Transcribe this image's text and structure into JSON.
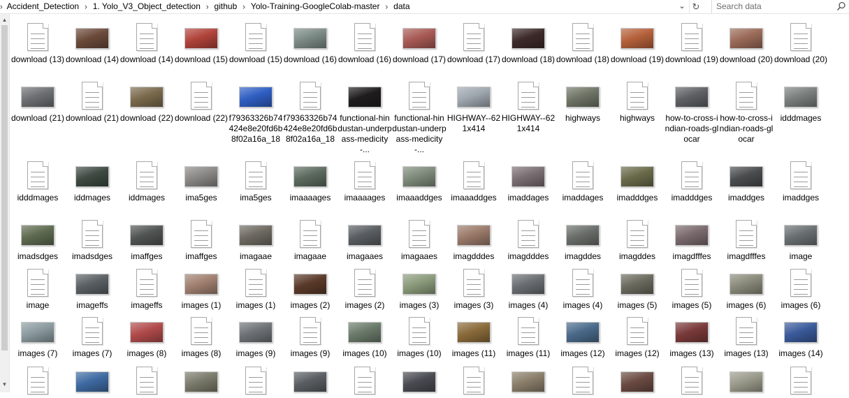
{
  "breadcrumb": [
    "Accident_Detection",
    "1. Yolo_V3_Object_detection",
    "github",
    "Yolo-Training-GoogleColab-master",
    "data"
  ],
  "search": {
    "placeholder": "Search data"
  },
  "icons": {
    "separator": "chevron-right-icon",
    "dropdown": "chevron-down-icon",
    "refresh": "refresh-icon",
    "search": "search-icon"
  },
  "files": [
    {
      "name": "download (13)",
      "kind": "text",
      "color": ""
    },
    {
      "name": "download (14)",
      "kind": "image",
      "color": "#6b4a3a"
    },
    {
      "name": "download (14)",
      "kind": "text",
      "color": ""
    },
    {
      "name": "download (15)",
      "kind": "image",
      "color": "#b0433a"
    },
    {
      "name": "download (15)",
      "kind": "text",
      "color": ""
    },
    {
      "name": "download (16)",
      "kind": "image",
      "color": "#7c8a86"
    },
    {
      "name": "download (16)",
      "kind": "text",
      "color": ""
    },
    {
      "name": "download (17)",
      "kind": "image",
      "color": "#a85a55"
    },
    {
      "name": "download (17)",
      "kind": "text",
      "color": ""
    },
    {
      "name": "download (18)",
      "kind": "image",
      "color": "#3d2a2a"
    },
    {
      "name": "download (18)",
      "kind": "text",
      "color": ""
    },
    {
      "name": "download (19)",
      "kind": "image",
      "color": "#b5603a"
    },
    {
      "name": "download (19)",
      "kind": "text",
      "color": ""
    },
    {
      "name": "download (20)",
      "kind": "image",
      "color": "#9a6a58"
    },
    {
      "name": "download (20)",
      "kind": "text",
      "color": ""
    },
    {
      "name": "download (21)",
      "kind": "image",
      "color": "#6d6f72"
    },
    {
      "name": "download (21)",
      "kind": "text",
      "color": ""
    },
    {
      "name": "download (22)",
      "kind": "image",
      "color": "#7a6a4c"
    },
    {
      "name": "download (22)",
      "kind": "text",
      "color": ""
    },
    {
      "name": "f79363326b74424e8e20fd6b8f02a16a_18",
      "kind": "image",
      "color": "#2f5ec2"
    },
    {
      "name": "f79363326b74424e8e20fd6b8f02a16a_18",
      "kind": "text",
      "color": ""
    },
    {
      "name": "functional-hindustan-underpass-medicity-...",
      "kind": "image",
      "color": "#1f1d1d"
    },
    {
      "name": "functional-hindustan-underpass-medicity-...",
      "kind": "text",
      "color": ""
    },
    {
      "name": "HIGHWAY--621x414",
      "kind": "image",
      "color": "#9ea6ae"
    },
    {
      "name": "HIGHWAY--621x414",
      "kind": "text",
      "color": ""
    },
    {
      "name": "highways",
      "kind": "image",
      "color": "#6f7466"
    },
    {
      "name": "highways",
      "kind": "text",
      "color": ""
    },
    {
      "name": "how-to-cross-indian-roads-glocar",
      "kind": "image",
      "color": "#5e6064"
    },
    {
      "name": "how-to-cross-indian-roads-glocar",
      "kind": "text",
      "color": ""
    },
    {
      "name": "idddmages",
      "kind": "image",
      "color": "#7a7f7d"
    },
    {
      "name": "idddmages",
      "kind": "text",
      "color": ""
    },
    {
      "name": "iddmages",
      "kind": "image",
      "color": "#3e4a42"
    },
    {
      "name": "iddmages",
      "kind": "text",
      "color": ""
    },
    {
      "name": "ima5ges",
      "kind": "image",
      "color": "#8a8886"
    },
    {
      "name": "ima5ges",
      "kind": "text",
      "color": ""
    },
    {
      "name": "imaaaages",
      "kind": "image",
      "color": "#5c6a5e"
    },
    {
      "name": "imaaaages",
      "kind": "text",
      "color": ""
    },
    {
      "name": "imaaaddges",
      "kind": "image",
      "color": "#7e8a7a"
    },
    {
      "name": "imaaaddges",
      "kind": "text",
      "color": ""
    },
    {
      "name": "imaddages",
      "kind": "image",
      "color": "#7a6e72"
    },
    {
      "name": "imaddages",
      "kind": "text",
      "color": ""
    },
    {
      "name": "imadddges",
      "kind": "image",
      "color": "#6a6a4a"
    },
    {
      "name": "imadddges",
      "kind": "text",
      "color": ""
    },
    {
      "name": "imaddges",
      "kind": "image",
      "color": "#4a4c4e"
    },
    {
      "name": "imaddges",
      "kind": "text",
      "color": ""
    },
    {
      "name": "imadsdges",
      "kind": "image",
      "color": "#5e6a50"
    },
    {
      "name": "imadsdges",
      "kind": "text",
      "color": ""
    },
    {
      "name": "imaffges",
      "kind": "image",
      "color": "#505452"
    },
    {
      "name": "imaffges",
      "kind": "text",
      "color": ""
    },
    {
      "name": "imagaae",
      "kind": "image",
      "color": "#6e6a62"
    },
    {
      "name": "imagaae",
      "kind": "text",
      "color": ""
    },
    {
      "name": "imagaaes",
      "kind": "image",
      "color": "#5a5e62"
    },
    {
      "name": "imagaaes",
      "kind": "text",
      "color": ""
    },
    {
      "name": "imagdddes",
      "kind": "image",
      "color": "#9a7a6a"
    },
    {
      "name": "imagdddes",
      "kind": "text",
      "color": ""
    },
    {
      "name": "imagddes",
      "kind": "image",
      "color": "#6a6e6a"
    },
    {
      "name": "imagddes",
      "kind": "text",
      "color": ""
    },
    {
      "name": "imagdfffes",
      "kind": "image",
      "color": "#7a6a6e"
    },
    {
      "name": "imagdfffes",
      "kind": "text",
      "color": ""
    },
    {
      "name": "image",
      "kind": "image",
      "color": "#6a7072"
    },
    {
      "name": "image",
      "kind": "text",
      "color": ""
    },
    {
      "name": "imageffs",
      "kind": "image",
      "color": "#5a6064"
    },
    {
      "name": "imageffs",
      "kind": "text",
      "color": ""
    },
    {
      "name": "images (1)",
      "kind": "image",
      "color": "#a08070"
    },
    {
      "name": "images (1)",
      "kind": "text",
      "color": ""
    },
    {
      "name": "images (2)",
      "kind": "image",
      "color": "#5a3a2a"
    },
    {
      "name": "images (2)",
      "kind": "text",
      "color": ""
    },
    {
      "name": "images (3)",
      "kind": "image",
      "color": "#8a9a7a"
    },
    {
      "name": "images (3)",
      "kind": "text",
      "color": ""
    },
    {
      "name": "images (4)",
      "kind": "image",
      "color": "#6a6e72"
    },
    {
      "name": "images (4)",
      "kind": "text",
      "color": ""
    },
    {
      "name": "images (5)",
      "kind": "image",
      "color": "#6a6a5e"
    },
    {
      "name": "images (5)",
      "kind": "text",
      "color": ""
    },
    {
      "name": "images (6)",
      "kind": "image",
      "color": "#8a8a7a"
    },
    {
      "name": "images (6)",
      "kind": "text",
      "color": ""
    },
    {
      "name": "images (7)",
      "kind": "image",
      "color": "#8a9a9e"
    },
    {
      "name": "images (7)",
      "kind": "text",
      "color": ""
    },
    {
      "name": "images (8)",
      "kind": "image",
      "color": "#b04a4a"
    },
    {
      "name": "images (8)",
      "kind": "text",
      "color": ""
    },
    {
      "name": "images (9)",
      "kind": "image",
      "color": "#6e7276"
    },
    {
      "name": "images (9)",
      "kind": "text",
      "color": ""
    },
    {
      "name": "images (10)",
      "kind": "image",
      "color": "#6a7a6a"
    },
    {
      "name": "images (10)",
      "kind": "text",
      "color": ""
    },
    {
      "name": "images (11)",
      "kind": "image",
      "color": "#8a6a3a"
    },
    {
      "name": "images (11)",
      "kind": "text",
      "color": ""
    },
    {
      "name": "images (12)",
      "kind": "image",
      "color": "#4a6a8a"
    },
    {
      "name": "images (12)",
      "kind": "text",
      "color": ""
    },
    {
      "name": "images (13)",
      "kind": "image",
      "color": "#7a3a3a"
    },
    {
      "name": "images (13)",
      "kind": "text",
      "color": ""
    },
    {
      "name": "images (14)",
      "kind": "image",
      "color": "#3a5a9a"
    },
    {
      "name": "",
      "kind": "text",
      "color": ""
    },
    {
      "name": "",
      "kind": "image",
      "color": "#3e6aa2"
    },
    {
      "name": "",
      "kind": "text",
      "color": ""
    },
    {
      "name": "",
      "kind": "image",
      "color": "#7a7a6a"
    },
    {
      "name": "",
      "kind": "text",
      "color": ""
    },
    {
      "name": "",
      "kind": "image",
      "color": "#5a5e62"
    },
    {
      "name": "",
      "kind": "text",
      "color": ""
    },
    {
      "name": "",
      "kind": "image",
      "color": "#4a4a52"
    },
    {
      "name": "",
      "kind": "text",
      "color": ""
    },
    {
      "name": "",
      "kind": "image",
      "color": "#8a7e6a"
    },
    {
      "name": "",
      "kind": "text",
      "color": ""
    },
    {
      "name": "",
      "kind": "image",
      "color": "#6a4a42"
    },
    {
      "name": "",
      "kind": "text",
      "color": ""
    },
    {
      "name": "",
      "kind": "image",
      "color": "#9a9a8a"
    },
    {
      "name": "",
      "kind": "text",
      "color": ""
    }
  ]
}
